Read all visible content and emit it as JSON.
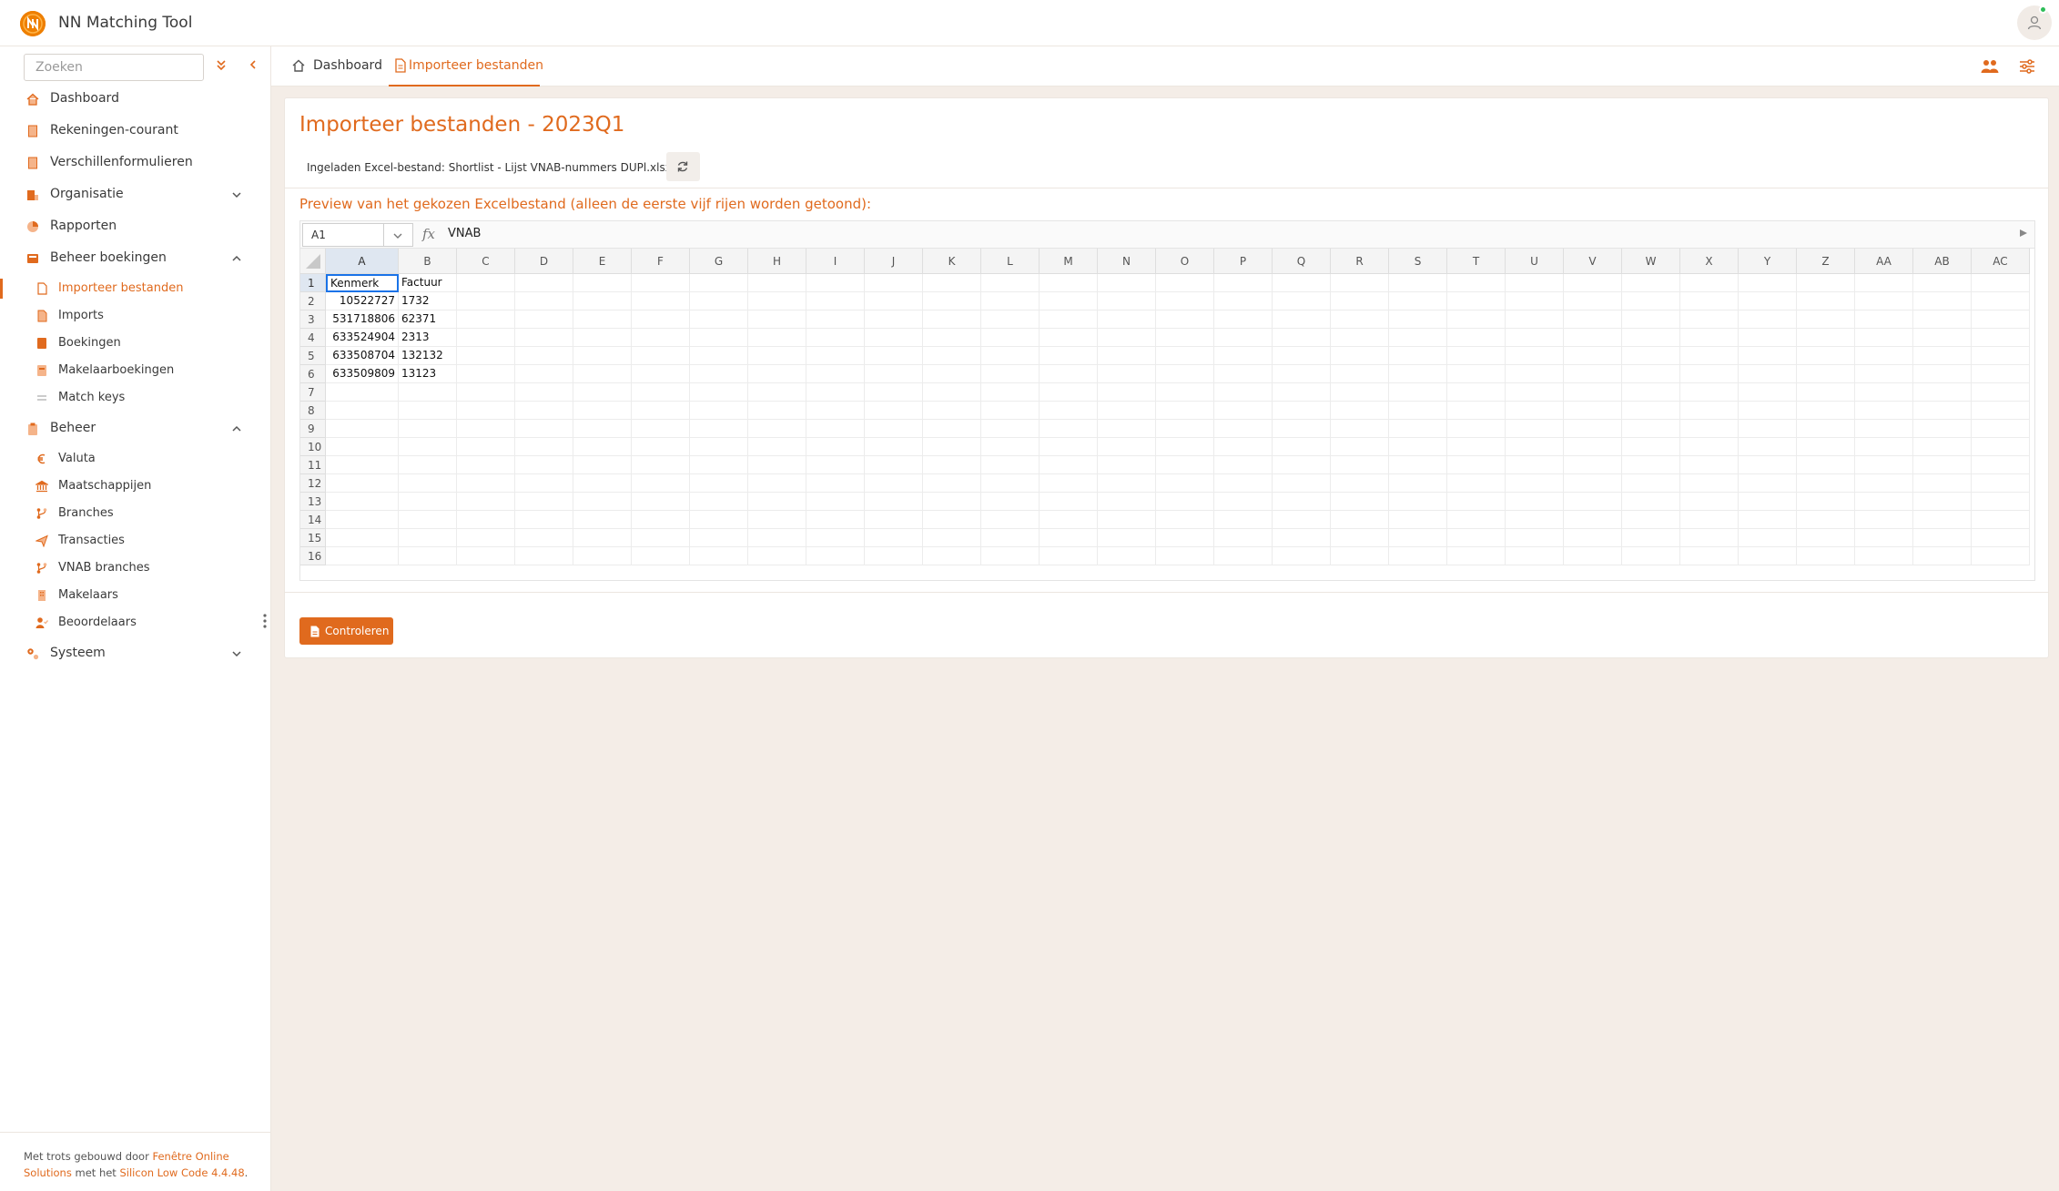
{
  "app": {
    "title": "NN Matching Tool"
  },
  "sidebar": {
    "search_placeholder": "Zoeken",
    "items": {
      "dashboard": "Dashboard",
      "rekeningen": "Rekeningen-courant",
      "verschillen": "Verschillenformulieren",
      "organisatie": "Organisatie",
      "rapporten": "Rapporten",
      "beheer_boekingen": "Beheer boekingen",
      "importeer": "Importeer bestanden",
      "imports": "Imports",
      "boekingen": "Boekingen",
      "makelaarboekingen": "Makelaarboekingen",
      "matchkeys": "Match keys",
      "beheer": "Beheer",
      "valuta": "Valuta",
      "maatschappijen": "Maatschappijen",
      "branches": "Branches",
      "transacties": "Transacties",
      "vnab_branches": "VNAB branches",
      "makelaars": "Makelaars",
      "beoordelaars": "Beoordelaars",
      "systeem": "Systeem"
    },
    "footer": {
      "prefix": "Met trots gebouwd door ",
      "company": "Fenêtre Online Solutions",
      "middle": " met het ",
      "product": "Silicon Low Code 4.4.48",
      "suffix": "."
    }
  },
  "tabs": {
    "dashboard": "Dashboard",
    "import": "Importeer bestanden"
  },
  "page": {
    "title": "Importeer bestanden - 2023Q1",
    "loaded_file": "Ingeladen Excel-bestand: Shortlist - Lijst VNAB-nummers DUPl.xlsx",
    "preview_label": "Preview van het gekozen Excelbestand (alleen de eerste vijf rijen worden getoond):",
    "check_button": "Controleren"
  },
  "sheet": {
    "namebox": "A1",
    "fx": "fx",
    "formula": "VNAB",
    "columns": [
      "A",
      "B",
      "C",
      "D",
      "E",
      "F",
      "G",
      "H",
      "I",
      "J",
      "K",
      "L",
      "M",
      "N",
      "O",
      "P",
      "Q",
      "R",
      "S",
      "T",
      "U",
      "V",
      "W",
      "X",
      "Y",
      "Z",
      "AA",
      "AB",
      "AC"
    ],
    "rows": [
      "1",
      "2",
      "3",
      "4",
      "5",
      "6",
      "7",
      "8",
      "9",
      "10",
      "11",
      "12",
      "13",
      "14",
      "15",
      "16"
    ],
    "data": [
      [
        "Kenmerk",
        "Factuur"
      ],
      [
        "10522727",
        "1732"
      ],
      [
        "531718806",
        "62371"
      ],
      [
        "633524904",
        "2313"
      ],
      [
        "633508704",
        "132132"
      ],
      [
        "633509809",
        "13123"
      ]
    ]
  },
  "colors": {
    "accent": "#e06a1e",
    "brand": "#ee7f00",
    "online": "#2ebd59"
  }
}
